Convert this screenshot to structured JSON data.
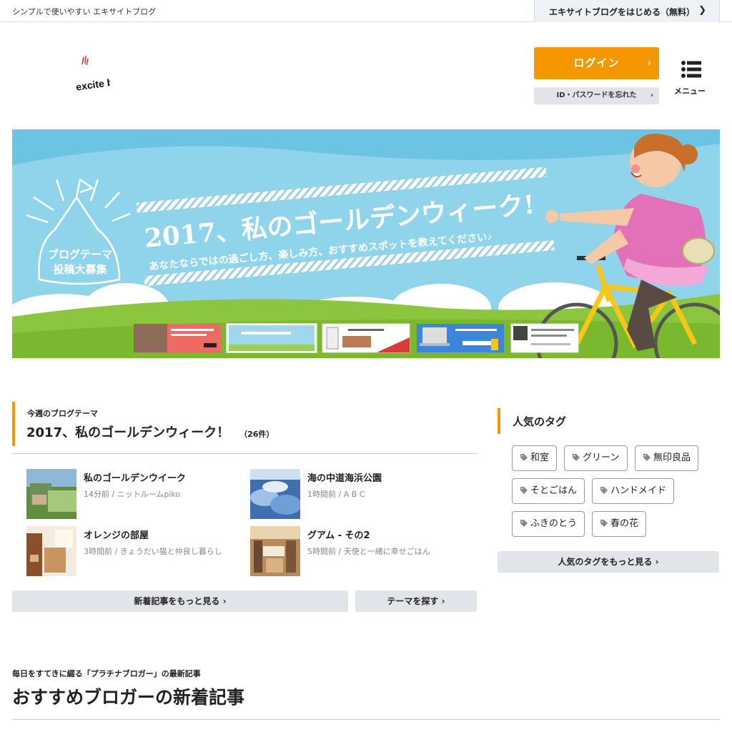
{
  "topbar": {
    "tagline": "シンプルで使いやすい エキサイトブログ",
    "start_label": "エキサイトブログをはじめる（無料）"
  },
  "header": {
    "logo_text": "excite blog",
    "login_label": "ログイン",
    "forgot_label": "ID・パスワードを忘れた",
    "menu_label": "メニュー"
  },
  "banner": {
    "badge_line1": "ブログテーマ",
    "badge_line2": "投稿大募集",
    "headline": "2017、私のゴールデンウィーク!",
    "subline": "あなたならではの過ごし方、楽しみ方、おすすめスポットを教えてください♪"
  },
  "theme": {
    "label": "今週のブログテーマ",
    "title": "2017、私のゴールデンウィーク！",
    "count": "（26件）",
    "articles": [
      {
        "title": "私のゴールデンウイーク",
        "meta": "14分前 / ニットルームpiko"
      },
      {
        "title": "海の中道海浜公園",
        "meta": "1時間前 / A B C"
      },
      {
        "title": "オレンジの部屋",
        "meta": "3時間前 / きょうだい猫と仲良し暮らし"
      },
      {
        "title": "グアム - その2",
        "meta": "5時間前 / 天使と一緒に幸せごはん"
      }
    ],
    "more_label": "新着記事をもっと見る",
    "search_label": "テーマを探す"
  },
  "tags": {
    "title": "人気のタグ",
    "items": [
      "和室",
      "グリーン",
      "無印良品",
      "そとごはん",
      "ハンドメイド",
      "ふきのとう",
      "春の花"
    ],
    "more_label": "人気のタグをもっと見る"
  },
  "recommended": {
    "small": "毎日をすてきに綴る「プラチナブロガー」の最新記事",
    "title": "おすすめブロガーの新着記事"
  },
  "colors": {
    "accent": "#f39800",
    "button_gray": "#e1e4e8",
    "sky": "#8ed2e8",
    "grass": "#8cc63f"
  }
}
